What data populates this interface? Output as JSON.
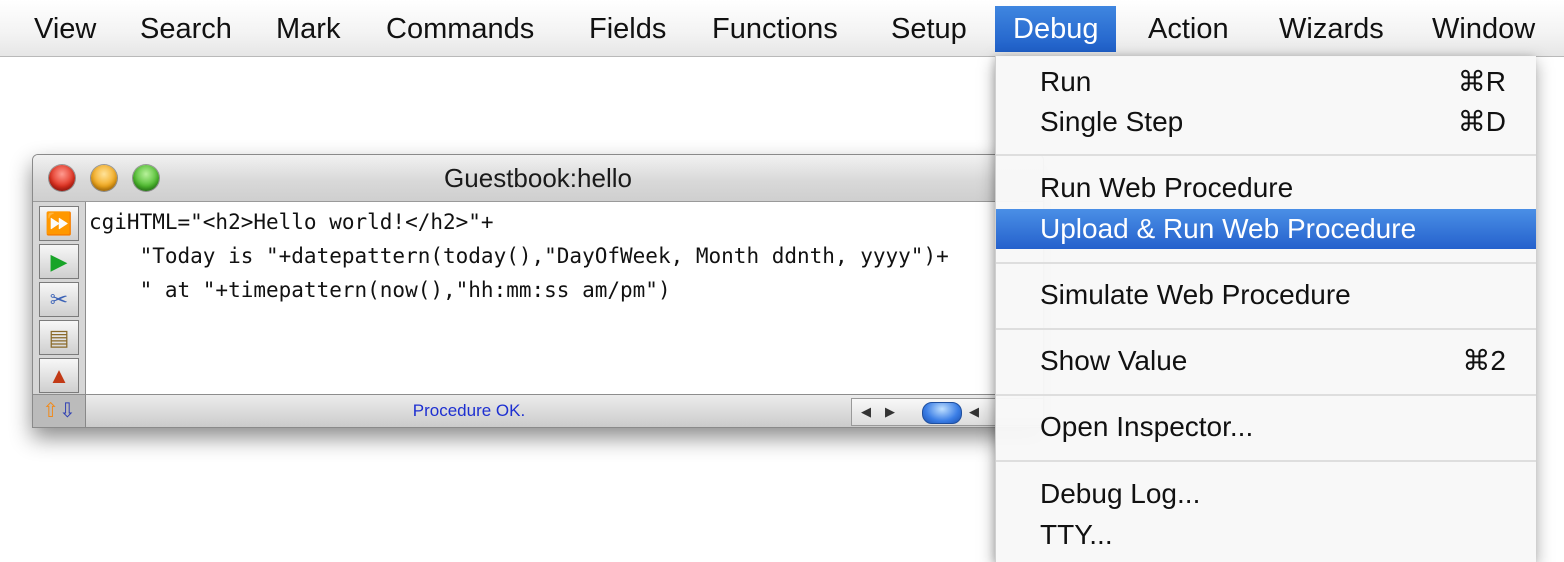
{
  "menubar": {
    "items": [
      "View",
      "Search",
      "Mark",
      "Commands",
      "Fields",
      "Functions",
      "Setup",
      "Debug",
      "Action",
      "Wizards",
      "Window"
    ],
    "active": "Debug"
  },
  "editor_window": {
    "title": "Guestbook:hello",
    "code_lines": [
      "cgiHTML=\"<h2>Hello world!</h2>\"+",
      "    \"Today is \"+datepattern(today(),\"DayOfWeek, Month ddnth, yyyy\")+",
      "    \" at \"+timepattern(now(),\"hh:mm:ss am/pm\")"
    ],
    "status": "Procedure OK.",
    "tools": [
      "fast-forward-icon",
      "play-icon",
      "scissors-icon",
      "book-icon",
      "stamp-icon"
    ]
  },
  "debug_menu": {
    "items": [
      {
        "label": "Run",
        "shortcut": "⌘R"
      },
      {
        "label": "Single Step",
        "shortcut": "⌘D"
      },
      {
        "label": "Run Web Procedure",
        "shortcut": ""
      },
      {
        "label": "Upload & Run Web Procedure",
        "shortcut": "",
        "highlighted": true
      },
      {
        "label": "Simulate Web Procedure",
        "shortcut": ""
      },
      {
        "label": "Show Value",
        "shortcut": "⌘2"
      },
      {
        "label": "Open Inspector...",
        "shortcut": ""
      },
      {
        "label": "Debug Log...",
        "shortcut": ""
      },
      {
        "label": "TTY...",
        "shortcut": ""
      }
    ]
  },
  "colors": {
    "highlight": "#2a67d0",
    "status_text": "#1d2fd1"
  }
}
